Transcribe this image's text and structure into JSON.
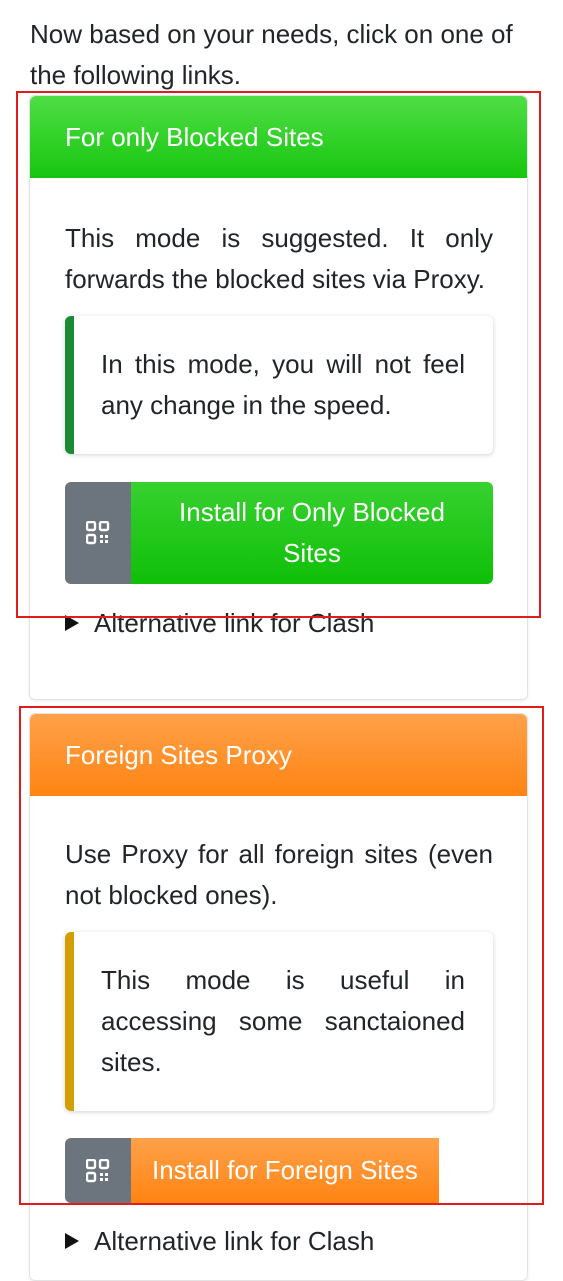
{
  "intro": "Now based on your needs, click on one of the following links.",
  "cards": [
    {
      "header": "For only Blocked Sites",
      "description": "This mode is suggested. It only forwards the blocked sites via Proxy.",
      "callout": "In this mode, you will not feel any change in the speed.",
      "button_label": "Install for Only Blocked Sites",
      "alt_link": "Alternative link for Clash",
      "accent": "#22c81a"
    },
    {
      "header": "Foreign Sites Proxy",
      "description": "Use Proxy for all foreign sites (even not blocked ones).",
      "callout": "This mode is useful in accessing some sanctaioned sites.",
      "button_label": "Install for Foreign Sites",
      "alt_link": "Alternative link for Clash",
      "accent": "#ff8a1e"
    }
  ],
  "icons": [
    "qr-code-icon",
    "disclosure-triangle-icon"
  ],
  "colors": {
    "highlight_frame": "#e41b1b",
    "icon_bg": "#6c757d"
  }
}
